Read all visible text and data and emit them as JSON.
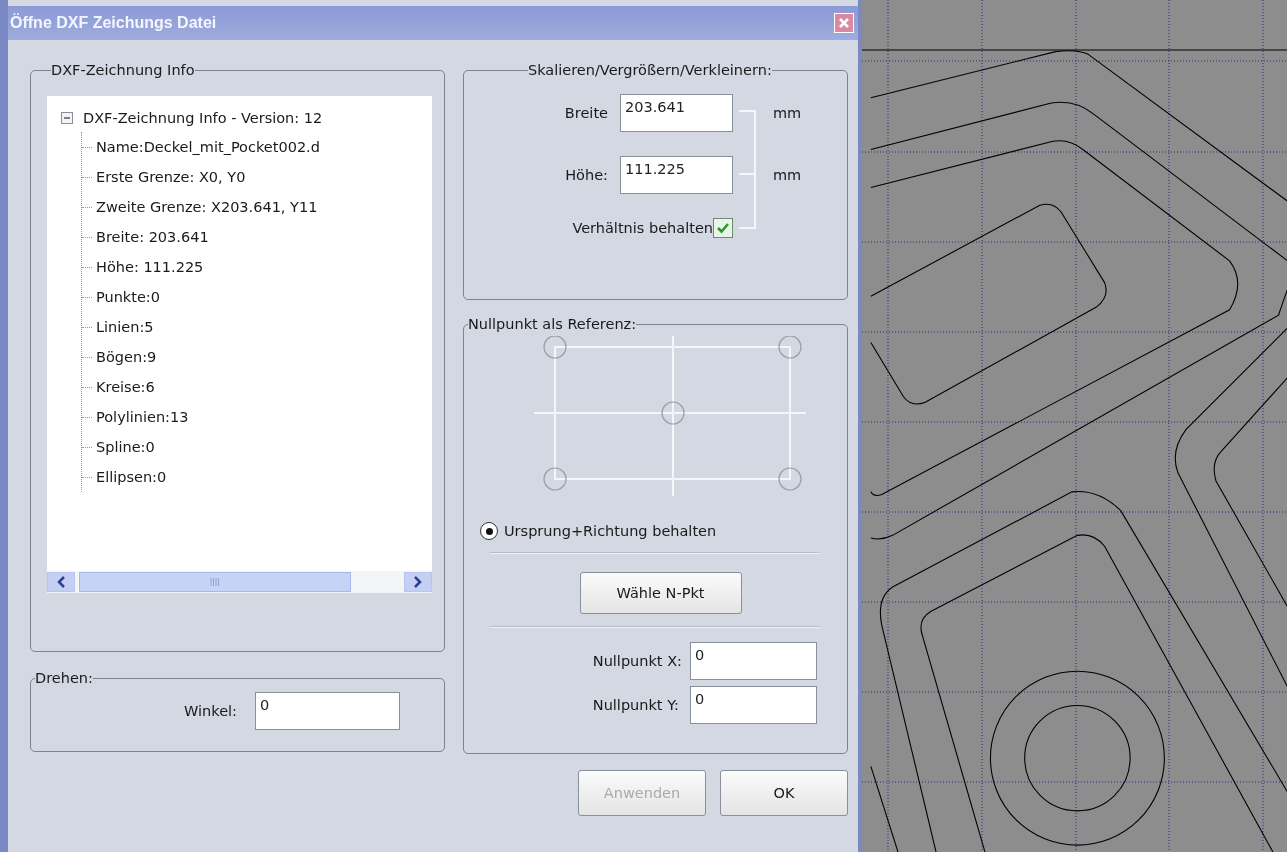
{
  "window": {
    "title": "Öffne DXF Zeichungs Datei"
  },
  "info_group": {
    "title": "DXF-Zeichnung Info",
    "tree": [
      {
        "label": "DXF-Zeichnung Info - Version: 12",
        "expanded": true,
        "children": [
          {
            "label": "Name:Deckel_mit_Pocket002.d"
          },
          {
            "label": "Erste Grenze: X0, Y0"
          },
          {
            "label": "Zweite Grenze: X203.641, Y11"
          },
          {
            "label": "Breite: 203.641"
          },
          {
            "label": "Höhe: 111.225"
          },
          {
            "label": "Punkte:0"
          },
          {
            "label": "Linien:5"
          },
          {
            "label": "Bögen:9"
          },
          {
            "label": "Kreise:6"
          },
          {
            "label": "Polylinien:13"
          },
          {
            "label": "Spline:0"
          },
          {
            "label": "Ellipsen:0"
          }
        ]
      }
    ]
  },
  "rotate_group": {
    "title": "Drehen:",
    "angle_label": "Winkel:",
    "angle_value": "0"
  },
  "scale_group": {
    "title": "Skalieren/Vergrößern/Verkleinern:",
    "width_label": "Breite",
    "width_value": "203.641",
    "width_unit": "mm",
    "height_label": "Höhe:",
    "height_value": "111.225",
    "height_unit": "mm",
    "keep_ratio_label": "Verhältnis behalten",
    "keep_ratio_checked": true
  },
  "origin_group": {
    "title": "Nullpunkt als Referenz:",
    "keep_origin_label": "Ursprung+Richtung behalten",
    "keep_origin_selected": true,
    "pick_button": "Wähle N-Pkt",
    "x_label": "Nullpunkt X:",
    "x_value": "0",
    "y_label": "Nullpunkt Y:",
    "y_value": "0"
  },
  "buttons": [
    {
      "label": "Anwenden",
      "disabled": true
    },
    {
      "label": "OK",
      "disabled": false
    }
  ]
}
